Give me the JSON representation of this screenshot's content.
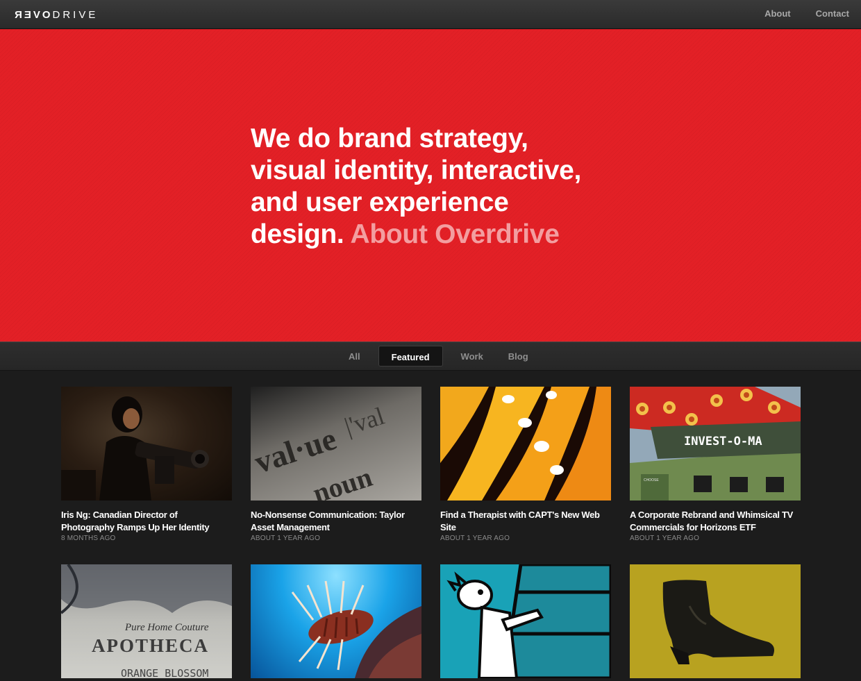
{
  "brand": {
    "mark": "OVER",
    "word": "DRIVE"
  },
  "nav": {
    "about": "About",
    "contact": "Contact"
  },
  "hero": {
    "line1": "We do brand strategy,",
    "line2": "visual identity, interactive,",
    "line3": "and user experience",
    "line4": "design.",
    "link": "About Overdrive"
  },
  "filters": [
    {
      "label": "All"
    },
    {
      "label": "Featured",
      "active": true
    },
    {
      "label": "Work"
    },
    {
      "label": "Blog"
    }
  ],
  "cards": [
    {
      "title": "Iris Ng: Canadian Director of Photography Ramps Up Her Identity",
      "date": "8 MONTHS AGO"
    },
    {
      "title": "No-Nonsense Communication: Taylor Asset Management",
      "date": "ABOUT 1 YEAR AGO"
    },
    {
      "title": "Find a Therapist with CAPT's New Web Site",
      "date": "ABOUT 1 YEAR AGO"
    },
    {
      "title": "A Corporate Rebrand and Whimsical TV Commercials for Horizons ETF",
      "date": "ABOUT 1 YEAR AGO"
    }
  ],
  "thumb_text": {
    "dictionary_a": "val·ue",
    "dictionary_b": "|'val",
    "dictionary_c": "noun",
    "sign": "INVEST-O-MA",
    "sign_small": "CHOOSE",
    "apothecary_script": "Pure Home Couture",
    "apothecary": "APOTHECA",
    "apothecary_sub": "ORANGE BLOSSOM"
  },
  "colors": {
    "hero": "#e32026",
    "hero_link": "#f39ea0",
    "page_bg": "#1c1c1c"
  }
}
